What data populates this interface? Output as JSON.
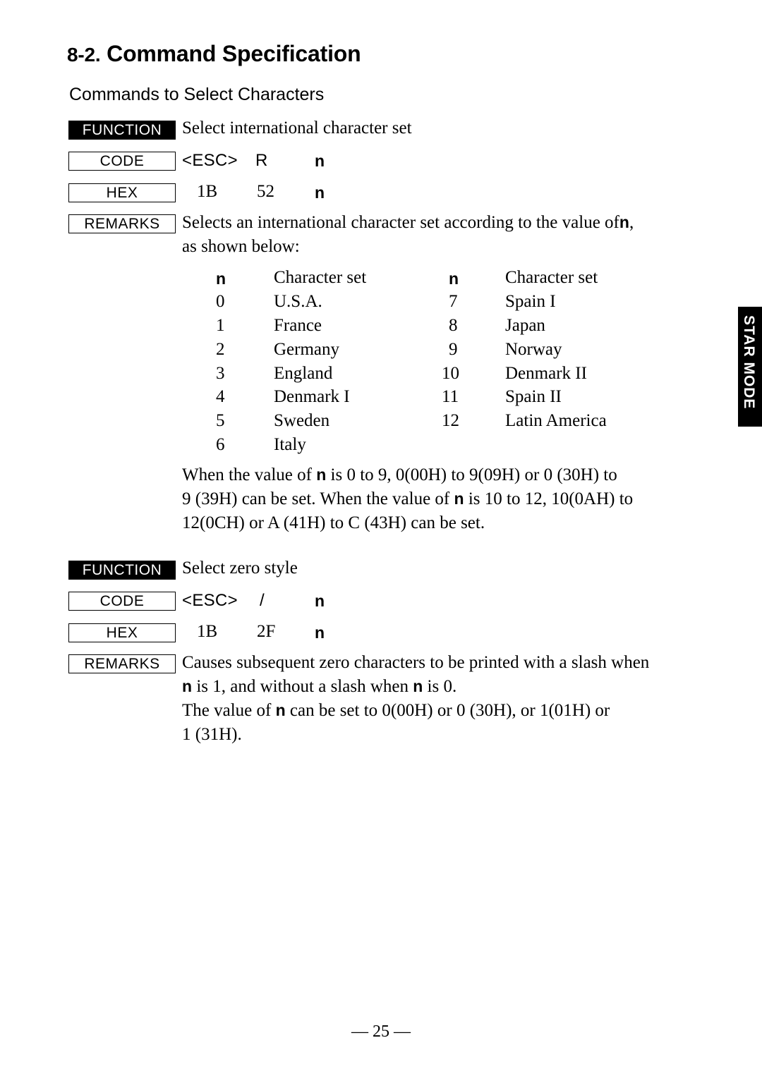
{
  "page": {
    "section_number": "8-2.",
    "section_title": "Command Specification",
    "subsection_title": "Commands to Select Characters",
    "side_tab": "STAR MODE",
    "footer": "— 25 —"
  },
  "labels": {
    "function": "FUNCTION",
    "code": "CODE",
    "hex": "HEX",
    "remarks": "REMARKS"
  },
  "command1": {
    "function_text": "Select international character set",
    "code_esc": "<ESC>",
    "code_char": "R",
    "code_n": "n",
    "hex_1": "1B",
    "hex_2": "52",
    "hex_n": "n",
    "remarks_line1_a": "Selects an international character set according to the value of",
    "remarks_line1_n": "n",
    "remarks_line1_b": ",",
    "remarks_line2": "as shown below:",
    "table": {
      "header_n_left": "n",
      "header_set_left": "Character set",
      "header_n_right": "n",
      "header_set_right": "Character set",
      "rows_left": [
        {
          "n": "0",
          "set": "U.S.A."
        },
        {
          "n": "1",
          "set": "France"
        },
        {
          "n": "2",
          "set": "Germany"
        },
        {
          "n": "3",
          "set": "England"
        },
        {
          "n": "4",
          "set": "Denmark I"
        },
        {
          "n": "5",
          "set": "Sweden"
        },
        {
          "n": "6",
          "set": "Italy"
        }
      ],
      "rows_right": [
        {
          "n": "7",
          "set": "Spain I"
        },
        {
          "n": "8",
          "set": "Japan"
        },
        {
          "n": "9",
          "set": "Norway"
        },
        {
          "n": "10",
          "set": "Denmark II"
        },
        {
          "n": "11",
          "set": "Spain II"
        },
        {
          "n": "12",
          "set": "Latin America"
        }
      ]
    },
    "note_line1_a": "When the value of",
    "note_line1_n": "n",
    "note_line1_b": "is 0 to 9, 0(00H) to 9(09H) or  0 (30H) to",
    "note_line2_a": "9 (39H) can be set. When the value of",
    "note_line2_n": "n",
    "note_line2_b": "is 10 to 12, 10(0AH) to",
    "note_line3": "12(0CH) or  A (41H) to  C (43H) can be set."
  },
  "command2": {
    "function_text": "Select zero style",
    "code_esc": "<ESC>",
    "code_char": "/",
    "code_n": "n",
    "hex_1": "1B",
    "hex_2": "2F",
    "hex_n": "n",
    "remarks_line1": "Causes subsequent zero characters to be printed with a slash when",
    "remarks_line2_n1": "n",
    "remarks_line2_a": "is 1, and without a slash when",
    "remarks_line2_n2": "n",
    "remarks_line2_b": "is 0.",
    "remarks_line3_a": "The value of",
    "remarks_line3_n": "n",
    "remarks_line3_b": "can be set to 0(00H) or  0 (30H), or 1(01H) or",
    "remarks_line4": "1 (31H)."
  }
}
